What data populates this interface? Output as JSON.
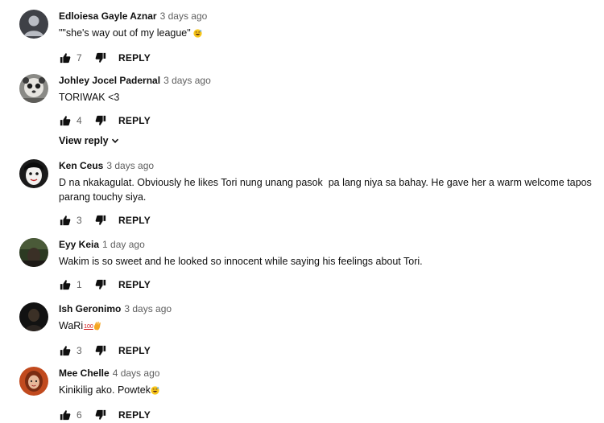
{
  "actions": {
    "reply_label": "REPLY",
    "view_reply_label": "View reply"
  },
  "comments": [
    {
      "author": "Edloiesa Gayle Aznar",
      "time": "3 days ago",
      "text": "\"\"she's way out of my league\"",
      "emoji": "grinning-sweat-face",
      "likes": "7",
      "avatar": "default-avatar"
    },
    {
      "author": "Johley Jocel Padernal",
      "time": "3 days ago",
      "text": "TORIWAK <3",
      "likes": "4",
      "has_replies": true,
      "avatar": "photo-avatar"
    },
    {
      "author": "Ken Ceus",
      "time": "3 days ago",
      "text": "D na nkakagulat. Obviously he likes Tori nung unang pasok  pa lang niya sa bahay. He gave her a warm welcome tapos parang touchy siya.",
      "likes": "3",
      "avatar": "photo-avatar"
    },
    {
      "author": "Eyy Keia",
      "time": "1 day ago",
      "text": "Wakim is so sweet and he looked so innocent while saying his feelings about Tori.",
      "likes": "1",
      "avatar": "photo-avatar"
    },
    {
      "author": "Ish Geronimo",
      "time": "3 days ago",
      "text": "WaRi",
      "emoji_badge": "100",
      "emoji": "ok-hand",
      "likes": "3",
      "avatar": "photo-avatar"
    },
    {
      "author": "Mee Chelle",
      "time": "4 days ago",
      "text": "Kinikilig ako. Powtek",
      "emoji": "grinning-sweat-face",
      "likes": "6",
      "avatar": "photo-avatar"
    }
  ],
  "colors": {
    "text_primary": "#0f0f0f",
    "text_secondary": "#606060",
    "default_avatar_bg": "#3f4147",
    "default_avatar_fg": "#b9bcc3"
  }
}
